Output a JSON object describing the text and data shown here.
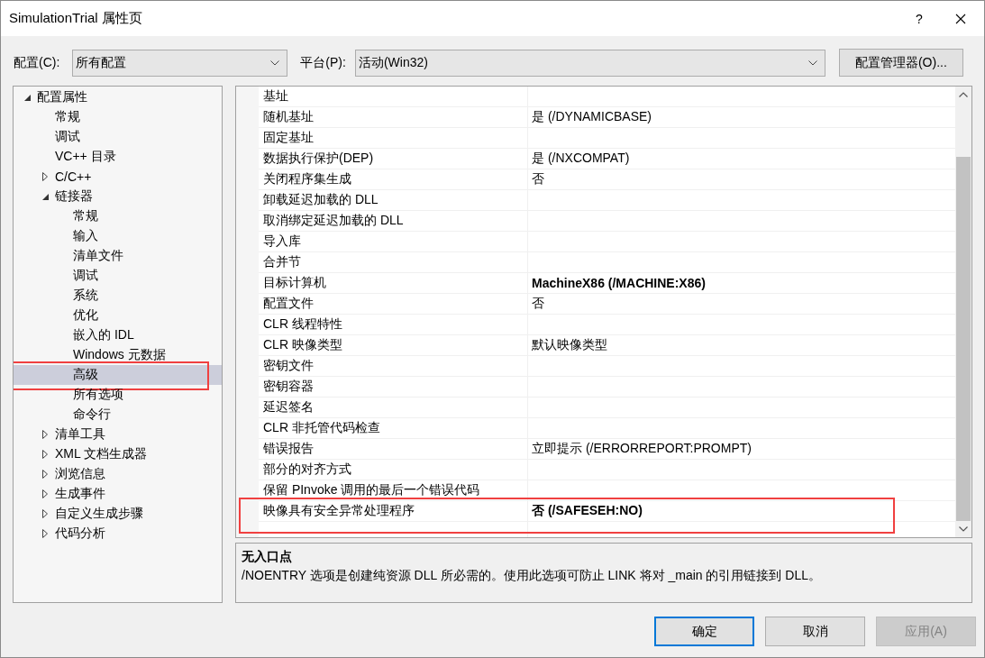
{
  "window": {
    "title": "SimulationTrial 属性页",
    "help": "?"
  },
  "toolbar": {
    "configuration": {
      "label": "配置(C):",
      "value": "所有配置"
    },
    "platform": {
      "label": "平台(P):",
      "value": "活动(Win32)"
    },
    "manager_button": "配置管理器(O)..."
  },
  "tree": [
    {
      "label": "配置属性",
      "kind": "node",
      "expanded": true,
      "selected": false,
      "highlighted": false,
      "children": [
        {
          "label": "常规",
          "kind": "leaf",
          "selected": false,
          "highlighted": false
        },
        {
          "label": "调试",
          "kind": "leaf",
          "selected": false,
          "highlighted": false
        },
        {
          "label": "VC++ 目录",
          "kind": "leaf",
          "selected": false,
          "highlighted": false
        },
        {
          "label": "C/C++",
          "kind": "node",
          "expanded": false,
          "selected": false,
          "highlighted": false
        },
        {
          "label": "链接器",
          "kind": "node",
          "expanded": true,
          "selected": false,
          "highlighted": false,
          "children": [
            {
              "label": "常规",
              "kind": "leaf",
              "selected": false,
              "highlighted": false
            },
            {
              "label": "输入",
              "kind": "leaf",
              "selected": false,
              "highlighted": false
            },
            {
              "label": "清单文件",
              "kind": "leaf",
              "selected": false,
              "highlighted": false
            },
            {
              "label": "调试",
              "kind": "leaf",
              "selected": false,
              "highlighted": false
            },
            {
              "label": "系统",
              "kind": "leaf",
              "selected": false,
              "highlighted": false
            },
            {
              "label": "优化",
              "kind": "leaf",
              "selected": false,
              "highlighted": false
            },
            {
              "label": "嵌入的 IDL",
              "kind": "leaf",
              "selected": false,
              "highlighted": false
            },
            {
              "label": "Windows 元数据",
              "kind": "leaf",
              "selected": false,
              "highlighted": false
            },
            {
              "label": "高级",
              "kind": "leaf",
              "selected": true,
              "highlighted": true
            },
            {
              "label": "所有选项",
              "kind": "leaf",
              "selected": false,
              "highlighted": false
            },
            {
              "label": "命令行",
              "kind": "leaf",
              "selected": false,
              "highlighted": false
            }
          ]
        },
        {
          "label": "清单工具",
          "kind": "node",
          "expanded": false,
          "selected": false,
          "highlighted": false
        },
        {
          "label": "XML 文档生成器",
          "kind": "node",
          "expanded": false,
          "selected": false,
          "highlighted": false
        },
        {
          "label": "浏览信息",
          "kind": "node",
          "expanded": false,
          "selected": false,
          "highlighted": false
        },
        {
          "label": "生成事件",
          "kind": "node",
          "expanded": false,
          "selected": false,
          "highlighted": false
        },
        {
          "label": "自定义生成步骤",
          "kind": "node",
          "expanded": false,
          "selected": false,
          "highlighted": false
        },
        {
          "label": "代码分析",
          "kind": "node",
          "expanded": false,
          "selected": false,
          "highlighted": false
        }
      ]
    }
  ],
  "properties": {
    "rows": [
      {
        "name": "基址",
        "highlighted": false
      },
      {
        "name": "随机基址",
        "value": "是 (/DYNAMICBASE)",
        "bold": false,
        "highlighted": false
      },
      {
        "name": "固定基址",
        "highlighted": false
      },
      {
        "name": "数据执行保护(DEP)",
        "value": "是 (/NXCOMPAT)",
        "bold": false,
        "highlighted": false
      },
      {
        "name": "关闭程序集生成",
        "value": "否",
        "bold": false,
        "highlighted": false
      },
      {
        "name": "卸载延迟加载的 DLL",
        "highlighted": false
      },
      {
        "name": "取消绑定延迟加载的 DLL",
        "highlighted": false
      },
      {
        "name": "导入库",
        "highlighted": false
      },
      {
        "name": "合并节",
        "highlighted": false
      },
      {
        "name": "目标计算机",
        "value": "MachineX86 (/MACHINE:X86)",
        "bold": true,
        "highlighted": false
      },
      {
        "name": "配置文件",
        "value": "否",
        "bold": false,
        "highlighted": false
      },
      {
        "name": "CLR 线程特性",
        "highlighted": false
      },
      {
        "name": "CLR 映像类型",
        "value": "默认映像类型",
        "bold": false,
        "highlighted": false
      },
      {
        "name": "密钥文件",
        "highlighted": false
      },
      {
        "name": "密钥容器",
        "highlighted": false
      },
      {
        "name": "延迟签名",
        "highlighted": false
      },
      {
        "name": "CLR 非托管代码检查",
        "highlighted": false
      },
      {
        "name": "错误报告",
        "value": "立即提示 (/ERRORREPORT:PROMPT)",
        "bold": false,
        "highlighted": false
      },
      {
        "name": "部分的对齐方式",
        "highlighted": false
      },
      {
        "name": "保留 PInvoke 调用的最后一个错误代码",
        "highlighted": false
      },
      {
        "name": "映像具有安全异常处理程序",
        "value": "否 (/SAFESEH:NO)",
        "bold": true,
        "highlighted": true
      }
    ]
  },
  "description": {
    "title": "无入口点",
    "text": "/NOENTRY 选项是创建纯资源 DLL 所必需的。使用此选项可防止 LINK 将对 _main 的引用链接到 DLL。"
  },
  "buttons": [
    {
      "label": "确定",
      "default": true,
      "disabled": false
    },
    {
      "label": "取消",
      "default": false,
      "disabled": false
    },
    {
      "label": "应用(A)",
      "default": false,
      "disabled": true
    }
  ]
}
